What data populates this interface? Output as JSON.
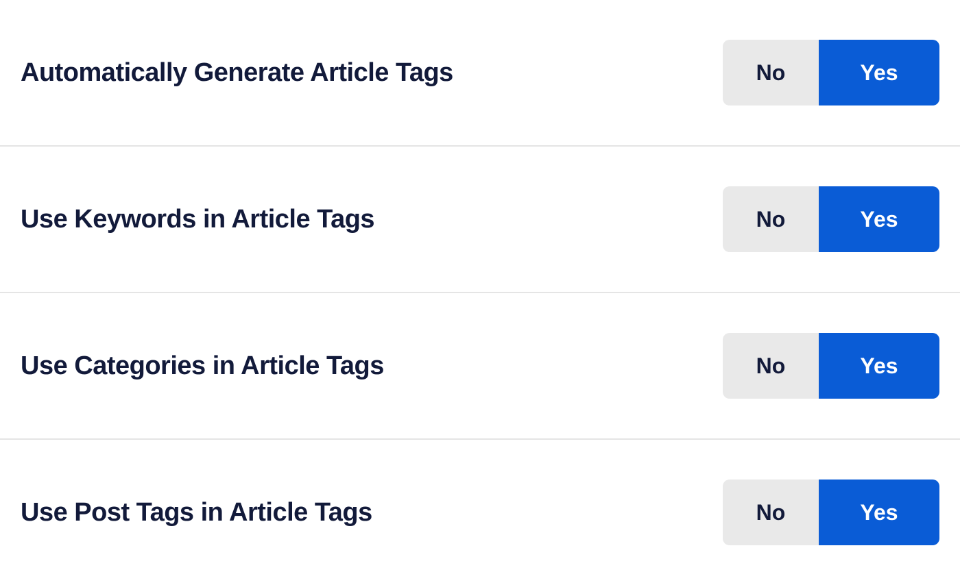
{
  "settings": [
    {
      "label": "Automatically Generate Article Tags",
      "no": "No",
      "yes": "Yes",
      "selected": "yes"
    },
    {
      "label": "Use Keywords in Article Tags",
      "no": "No",
      "yes": "Yes",
      "selected": "yes"
    },
    {
      "label": "Use Categories in Article Tags",
      "no": "No",
      "yes": "Yes",
      "selected": "yes"
    },
    {
      "label": "Use Post Tags in Article Tags",
      "no": "No",
      "yes": "Yes",
      "selected": "yes"
    }
  ]
}
